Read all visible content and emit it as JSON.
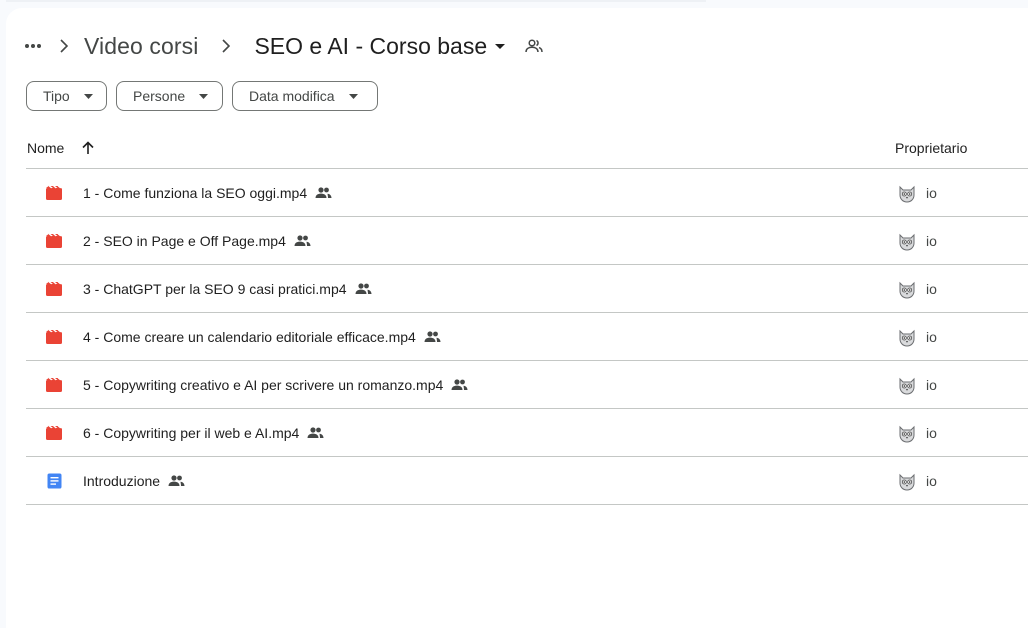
{
  "breadcrumb": {
    "more_icon": "more-horiz-icon",
    "parent": "Video corsi",
    "current": "SEO e AI - Corso base",
    "separator_icon": "chevron-right-icon",
    "dropdown_icon": "arrow-drop-down-icon",
    "shared_icon": "people-outline-icon"
  },
  "filters": {
    "type_label": "Tipo",
    "people_label": "Persone",
    "modified_label": "Data modifica"
  },
  "table": {
    "col_name": "Nome",
    "col_owner": "Proprietario",
    "sort_icon": "arrow-upward-icon",
    "rows": [
      {
        "name": "1 - Come funziona la SEO oggi.mp4",
        "type": "video",
        "owner": "io",
        "shared": true
      },
      {
        "name": "2 - SEO in Page e Off Page.mp4",
        "type": "video",
        "owner": "io",
        "shared": true
      },
      {
        "name": "3 - ChatGPT per la SEO 9 casi pratici.mp4",
        "type": "video",
        "owner": "io",
        "shared": true
      },
      {
        "name": "4 - Come creare un calendario editoriale efficace.mp4",
        "type": "video",
        "owner": "io",
        "shared": true
      },
      {
        "name": "5 - Copywriting creativo e AI per scrivere un romanzo.mp4",
        "type": "video",
        "owner": "io",
        "shared": true
      },
      {
        "name": "6 - Copywriting per il web e AI.mp4",
        "type": "video",
        "owner": "io",
        "shared": true
      },
      {
        "name": "Introduzione",
        "type": "doc",
        "owner": "io",
        "shared": true
      }
    ]
  },
  "colors": {
    "video_icon": "#ea4335",
    "doc_icon": "#4285f4",
    "divider": "#c4c7c5"
  }
}
